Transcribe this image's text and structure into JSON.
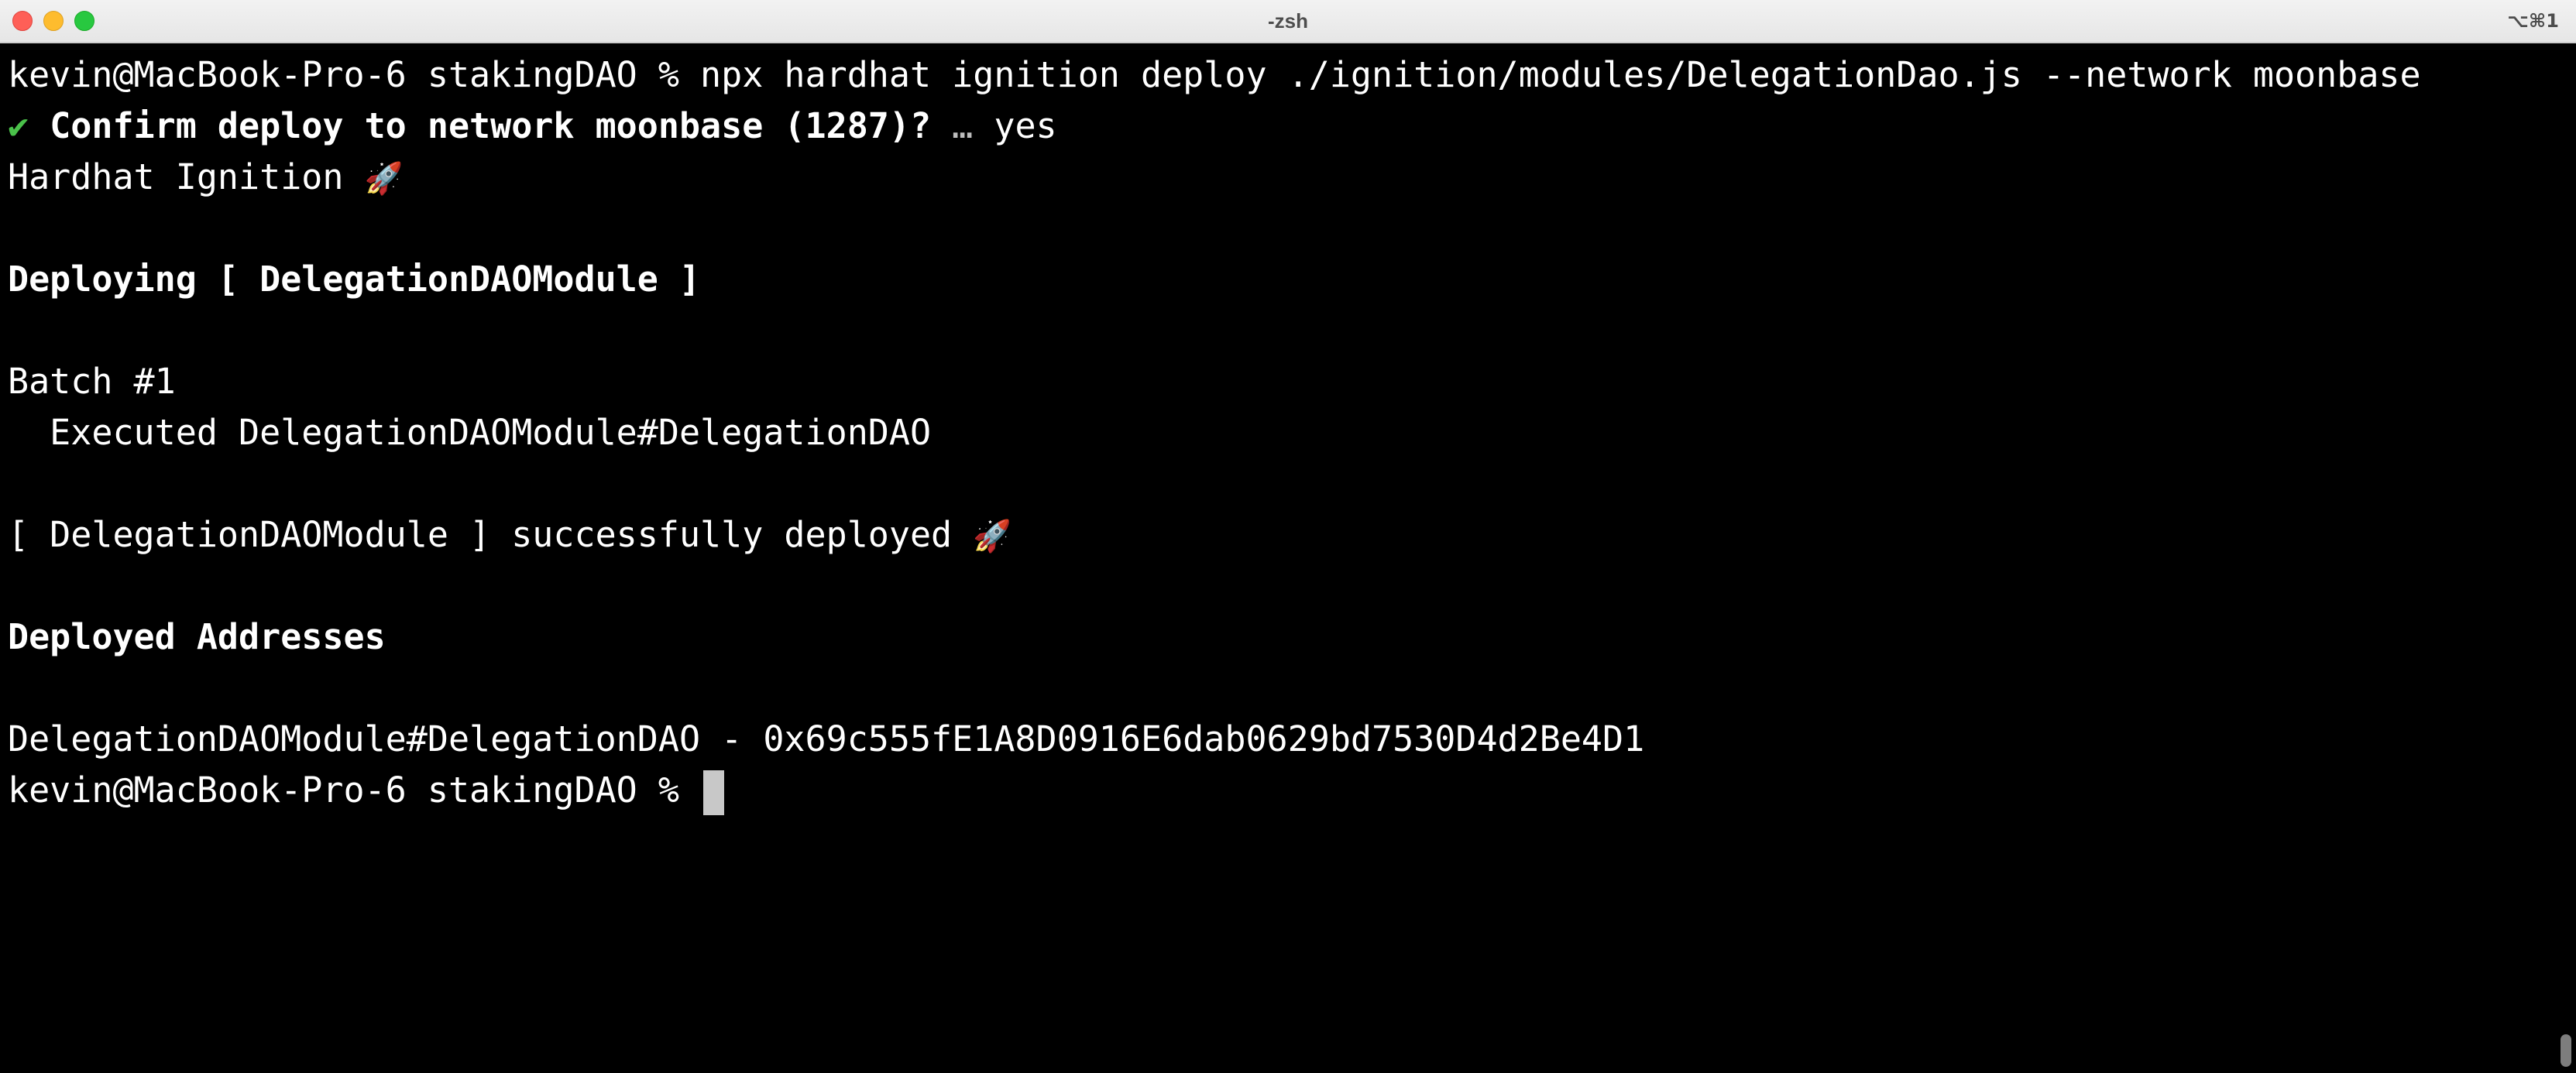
{
  "window": {
    "title": "-zsh",
    "shortcut": "⌥⌘1",
    "colors": {
      "background": "#000000",
      "text": "#ffffff",
      "check": "#4ac14a",
      "close": "#fe5f57",
      "minimize": "#febc2e",
      "zoom": "#28c840"
    }
  },
  "terminal": {
    "line1": "kevin@MacBook-Pro-6 stakingDAO % npx hardhat ignition deploy ./ignition/modules/DelegationDao.js --network moonbase",
    "line2_check": "✔",
    "line2_question": "Confirm deploy to network moonbase (1287)?",
    "line2_ellipsis": "…",
    "line2_answer": "yes",
    "line3_text": "Hardhat Ignition",
    "rocket": "🚀",
    "line5": "Deploying [ DelegationDAOModule ]",
    "line7": "Batch #1",
    "line8": "  Executed DelegationDAOModule#DelegationDAO",
    "line10_text": "[ DelegationDAOModule ] successfully deployed",
    "line12": "Deployed Addresses",
    "line14": "DelegationDAOModule#DelegationDAO - 0x69c555fE1A8D0916E6dab0629bd7530D4d2Be4D1",
    "prompt": "kevin@MacBook-Pro-6 stakingDAO %"
  }
}
